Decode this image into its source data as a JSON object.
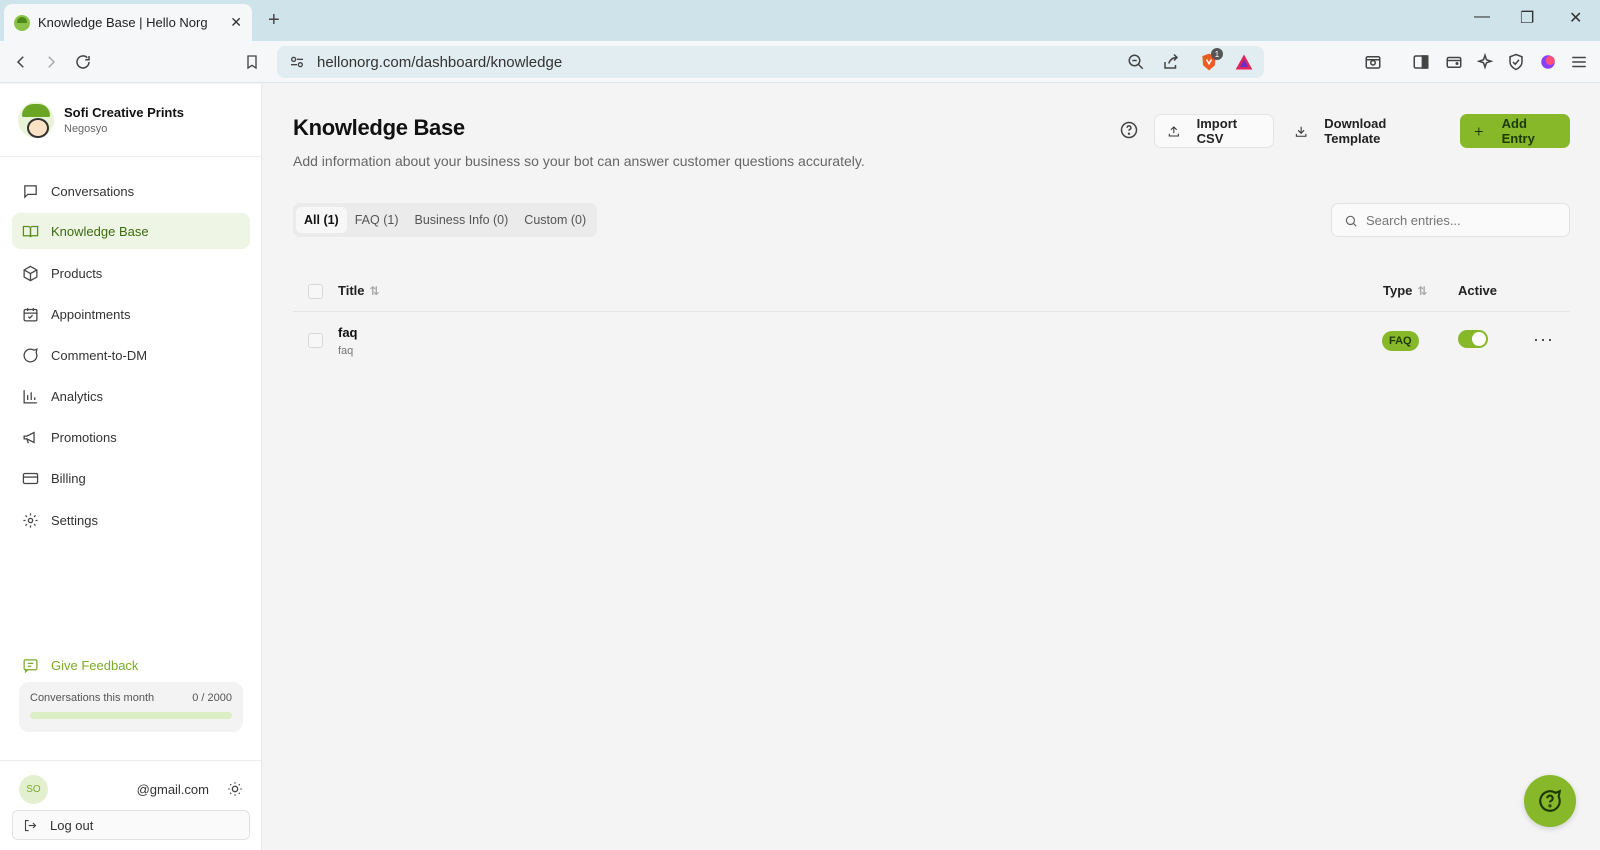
{
  "browser": {
    "tab_title": "Knowledge Base | Hello Norg",
    "url": "hellonorg.com/dashboard/knowledge",
    "new_tab": "+",
    "tab_close": "✕",
    "minimize": "—",
    "restore": "❐",
    "close": "✕",
    "brave_badge": "1"
  },
  "sidebar": {
    "brand_name": "Sofi Creative Prints",
    "brand_sub": "Negosyo",
    "items": [
      {
        "label": "Conversations",
        "icon": "message-square-icon"
      },
      {
        "label": "Knowledge Base",
        "icon": "book-open-icon"
      },
      {
        "label": "Products",
        "icon": "package-icon"
      },
      {
        "label": "Appointments",
        "icon": "calendar-check-icon"
      },
      {
        "label": "Comment-to-DM",
        "icon": "message-circle-icon"
      },
      {
        "label": "Analytics",
        "icon": "bar-chart-icon"
      },
      {
        "label": "Promotions",
        "icon": "megaphone-icon"
      },
      {
        "label": "Billing",
        "icon": "credit-card-icon"
      },
      {
        "label": "Settings",
        "icon": "gear-icon"
      }
    ],
    "feedback_label": "Give Feedback",
    "usage_label": "Conversations this month",
    "usage_value": "0 / 2000",
    "usage_fraction": 0,
    "user_initials": "SO",
    "user_email": "@gmail.com",
    "logout_label": "Log out"
  },
  "main": {
    "title": "Knowledge Base",
    "description": "Add information about your business so your bot can answer customer questions accurately.",
    "import_label": "Import CSV",
    "download_label": "Download Template",
    "add_label": "Add Entry",
    "filters": [
      "All (1)",
      "FAQ (1)",
      "Business Info (0)",
      "Custom (0)"
    ],
    "search_placeholder": "Search entries...",
    "columns": {
      "title": "Title",
      "type": "Type",
      "active": "Active"
    },
    "sort_glyph": "⇅",
    "rows": [
      {
        "title": "faq",
        "subtitle": "faq",
        "type": "FAQ",
        "active": true
      }
    ],
    "row_menu": "···"
  },
  "colors": {
    "accent": "#86b82a",
    "accent_dark": "#1d3a05",
    "active_bg": "#eef5e4"
  }
}
